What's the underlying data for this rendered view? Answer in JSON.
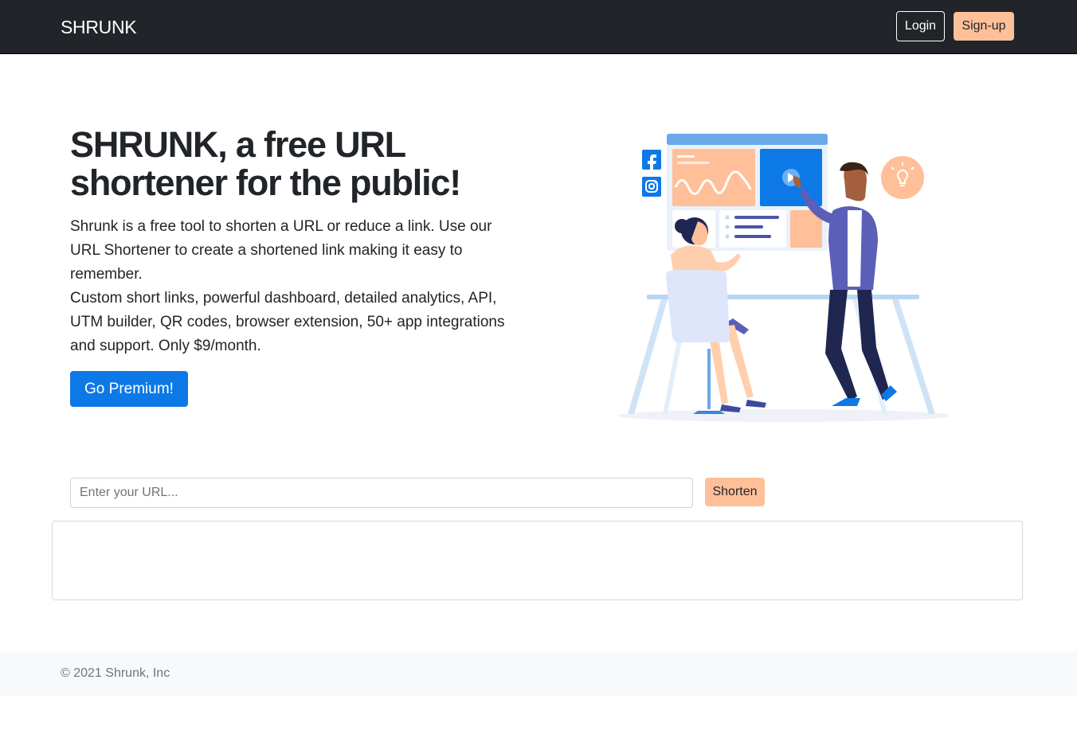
{
  "navbar": {
    "brand": "SHRUNK",
    "login_label": "Login",
    "signup_label": "Sign-up"
  },
  "hero": {
    "title": "SHRUNK, a free URL shortener for the public!",
    "paragraph1": "Shrunk is a free tool to shorten a URL or reduce a link. Use our URL Shortener to create a shortened link making it easy to remember.",
    "paragraph2": "Custom short links, powerful dashboard, detailed analytics, API, UTM builder, QR codes, browser extension, 50+ app integrations and support. Only $9/month.",
    "premium_button": "Go Premium!"
  },
  "illustration": {
    "icons": [
      "facebook-icon",
      "instagram-icon",
      "play-icon",
      "lightbulb-icon"
    ]
  },
  "url_form": {
    "placeholder": "Enter your URL...",
    "value": "",
    "shorten_button": "Shorten"
  },
  "footer": {
    "copyright": "© 2021 Shrunk, Inc"
  },
  "colors": {
    "navbar_bg": "#212529",
    "accent_peach": "#ffbf99",
    "primary_blue": "#0d79e6",
    "footer_bg": "#f8f9fa"
  }
}
